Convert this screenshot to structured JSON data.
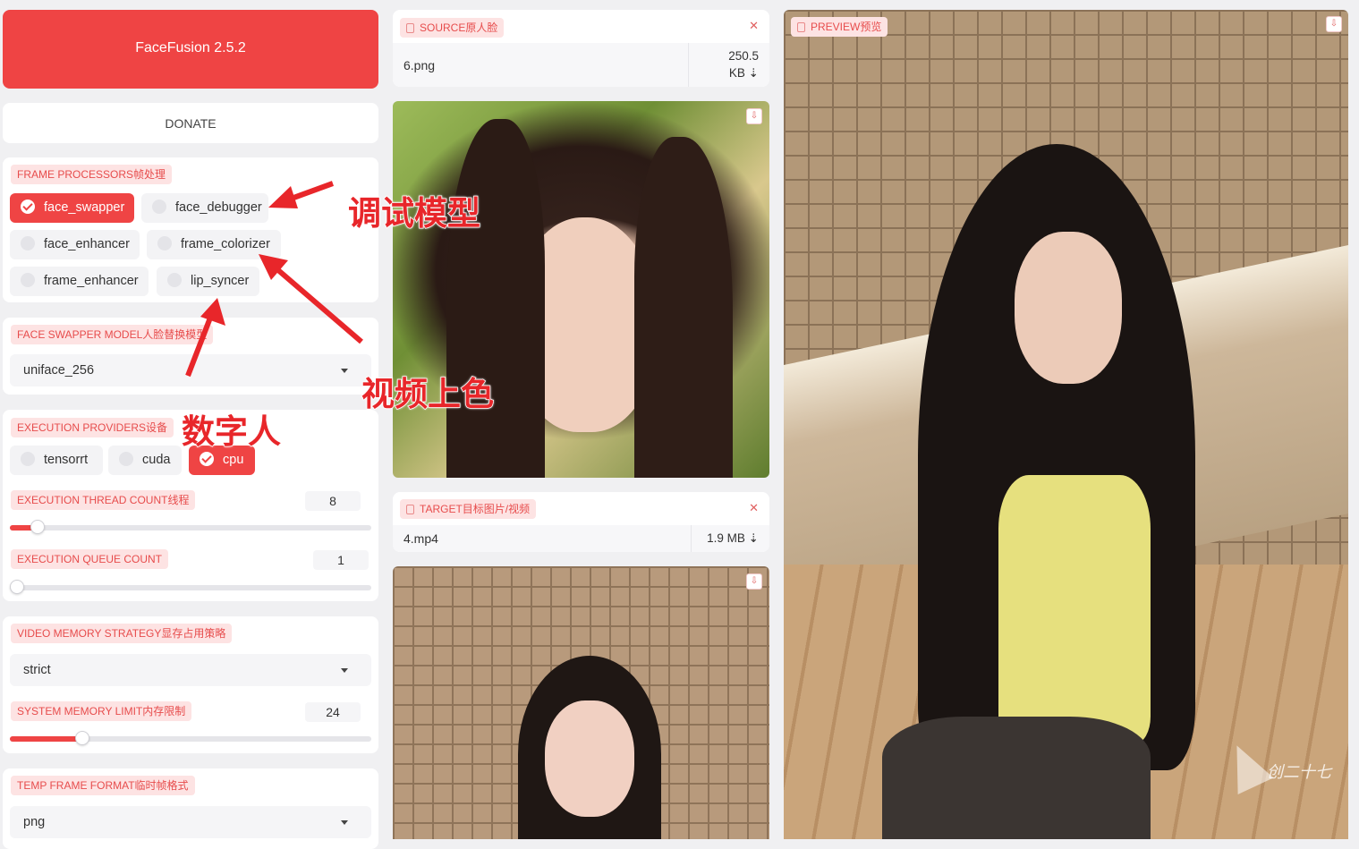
{
  "app": {
    "title": "FaceFusion 2.5.2",
    "donate_label": "DONATE"
  },
  "colors": {
    "accent": "#ef4444",
    "chip_bg": "#fde3e3",
    "chip_text": "#e74c4c",
    "annotation": "#e8262a"
  },
  "frame_processors": {
    "label": "FRAME PROCESSORS帧处理",
    "options": [
      {
        "label": "face_swapper",
        "checked": true
      },
      {
        "label": "face_debugger",
        "checked": false
      },
      {
        "label": "face_enhancer",
        "checked": false
      },
      {
        "label": "frame_colorizer",
        "checked": false
      },
      {
        "label": "frame_enhancer",
        "checked": false
      },
      {
        "label": "lip_syncer",
        "checked": false
      }
    ]
  },
  "face_swapper_model": {
    "label": "FACE SWAPPER MODEL人脸替换模型",
    "value": "uniface_256"
  },
  "execution_providers": {
    "label": "EXECUTION PROVIDERS设备",
    "options": [
      {
        "label": "tensorrt",
        "checked": false
      },
      {
        "label": "cuda",
        "checked": false
      },
      {
        "label": "cpu",
        "checked": true
      }
    ]
  },
  "execution_thread_count": {
    "label": "EXECUTION THREAD COUNT线程",
    "value": "8",
    "fraction": 0.076
  },
  "execution_queue_count": {
    "label": "EXECUTION QUEUE COUNT",
    "value": "1",
    "fraction": 0.0
  },
  "video_memory_strategy": {
    "label": "VIDEO MEMORY STRATEGY显存占用策略",
    "value": "strict"
  },
  "system_memory_limit": {
    "label": "SYSTEM MEMORY LIMIT内存限制",
    "value": "24",
    "fraction": 0.2
  },
  "temp_frame_format": {
    "label": "TEMP FRAME FORMAT临时帧格式",
    "value": "png"
  },
  "source": {
    "label": "SOURCE原人脸",
    "file_name": "6.png",
    "file_size_line1": "250.5",
    "file_size_line2": "KB ⇣"
  },
  "target": {
    "label": "TARGET目标图片/视频",
    "file_name": "4.mp4",
    "file_size": "1.9 MB ⇣"
  },
  "preview": {
    "label": "PREVIEW预览"
  },
  "icons": {
    "close": "close-icon",
    "download": "download-icon",
    "file": "file-icon",
    "image": "image-icon",
    "dropdown": "chevron-down-icon"
  },
  "annotations": {
    "debug_model": "调试模型",
    "video_colorize": "视频上色",
    "digital_human": "数字人"
  },
  "watermark": "创二十七"
}
